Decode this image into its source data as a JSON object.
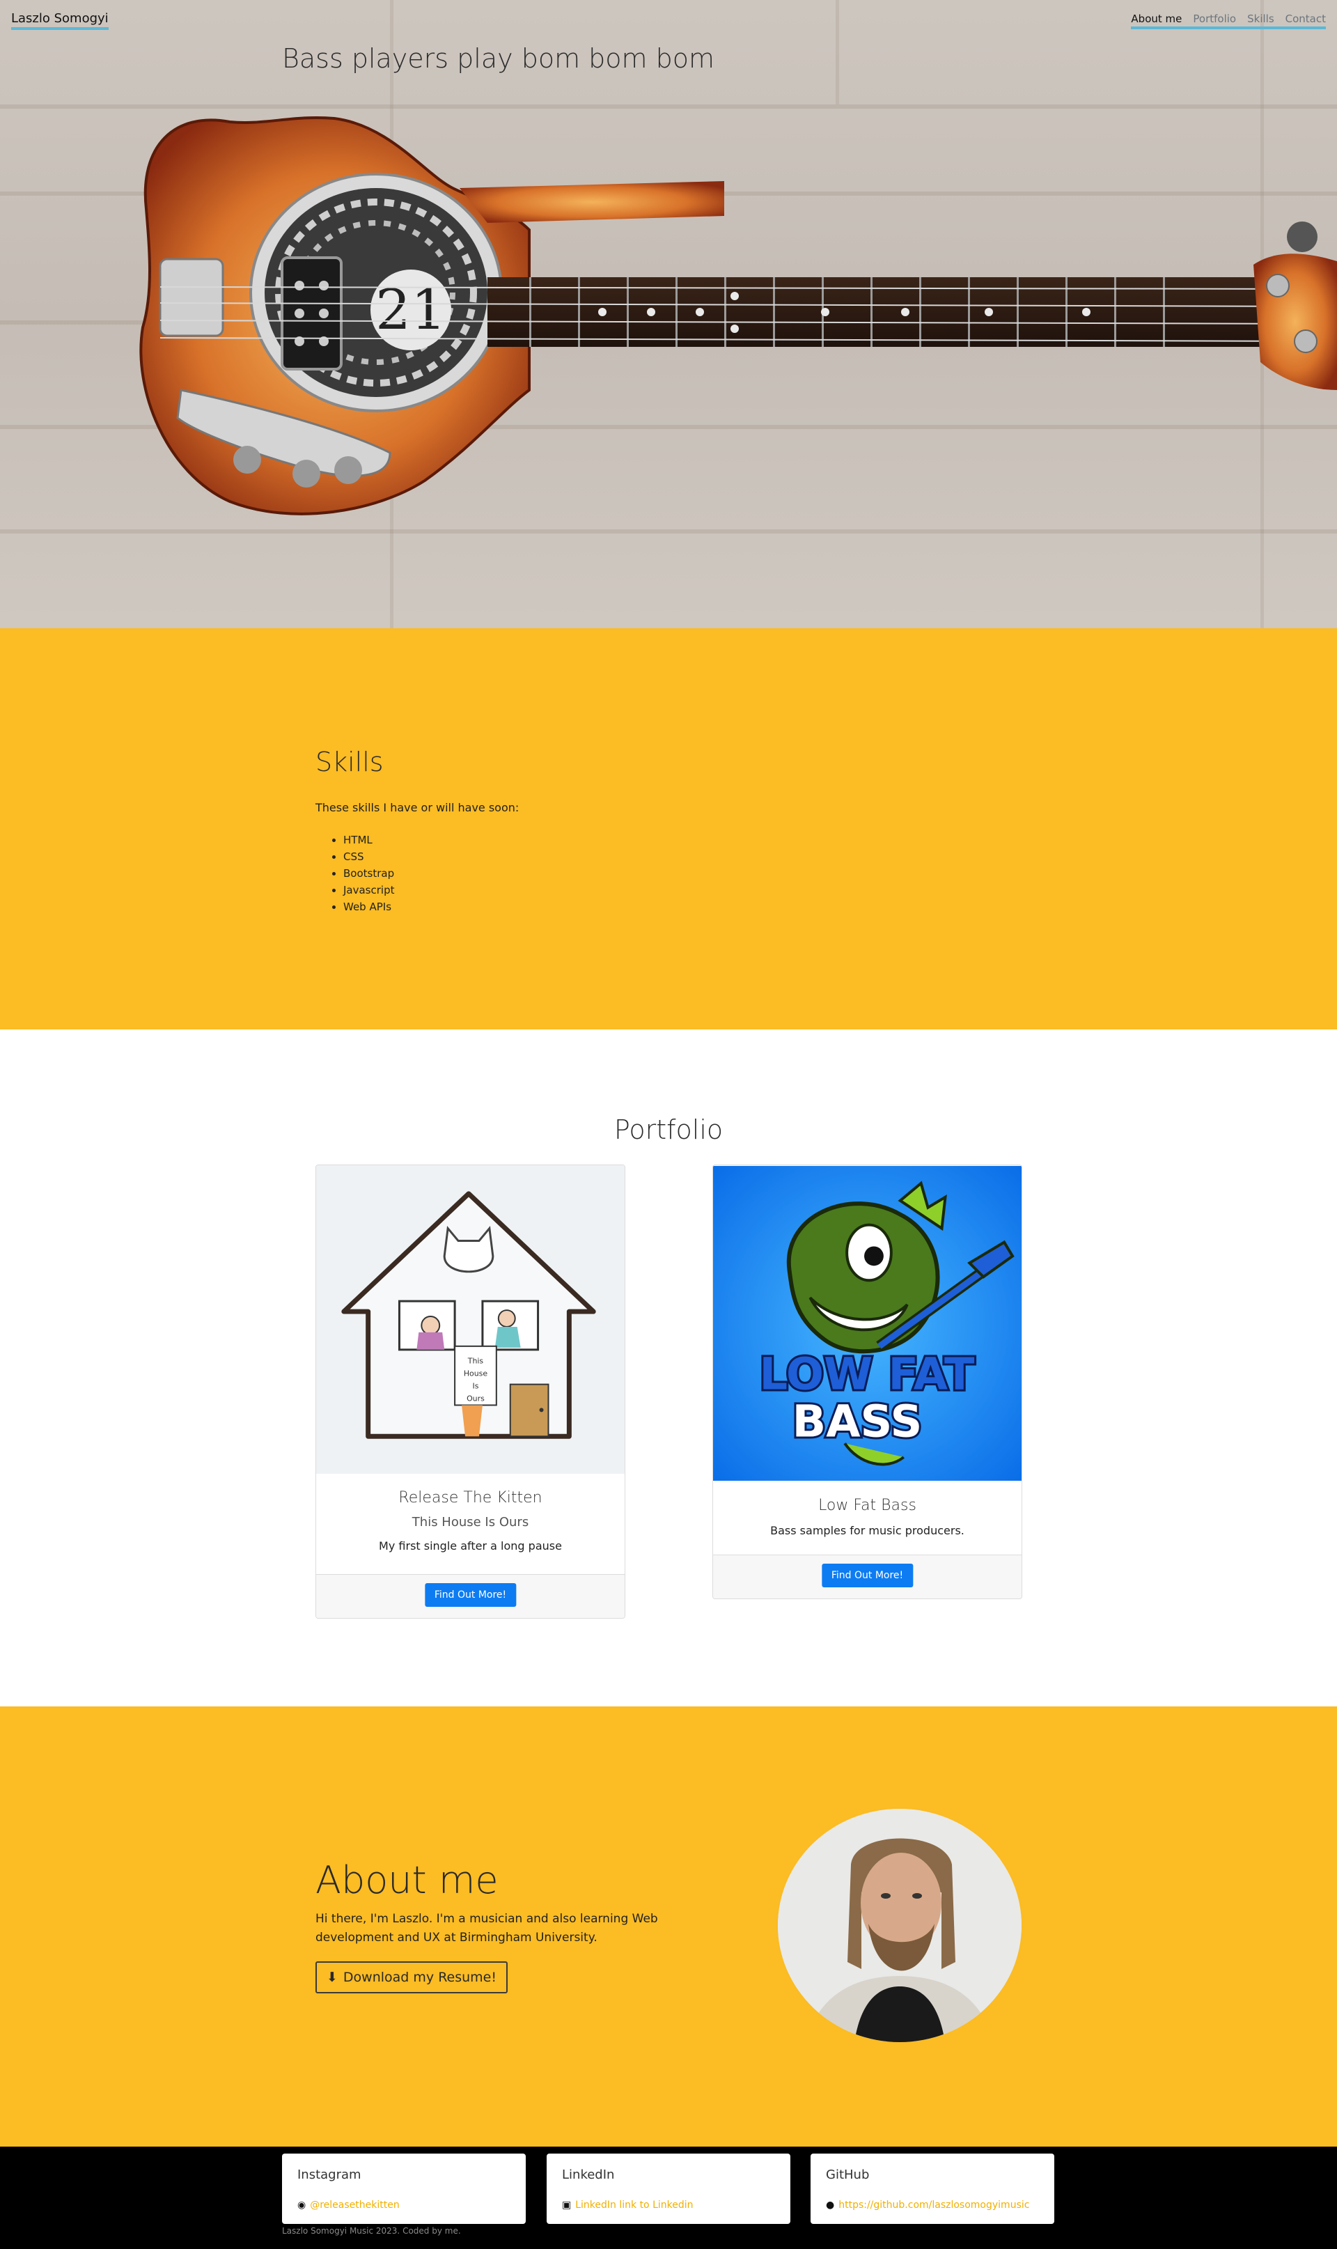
{
  "nav": {
    "brand": "Laszlo Somogyi",
    "links": [
      "About me",
      "Portfolio",
      "Skills",
      "Contact"
    ]
  },
  "hero": {
    "title": "Bass players play bom bom bom"
  },
  "skills": {
    "heading": "Skills",
    "intro": "These skills I have or will have soon:",
    "items": [
      "HTML",
      "CSS",
      "Bootstrap",
      "Javascript",
      "Web APIs"
    ]
  },
  "portfolio": {
    "heading": "Portfolio",
    "cards": [
      {
        "title": "Release The Kitten",
        "subtitle": "This House Is Ours",
        "text": "My first single after a long pause",
        "button": "Find Out More!"
      },
      {
        "title": "Low Fat Bass",
        "text": "Bass samples for music producers.",
        "button": "Find Out More!",
        "logo_line1": "LOW FAT",
        "logo_line2": "BASS"
      }
    ]
  },
  "about": {
    "heading": "About me",
    "text": "Hi there, I'm Laszlo. I'm a musician and also learning Web development and UX at Birmingham University.",
    "button": "Download my Resume!"
  },
  "footer": {
    "cards": [
      {
        "title": "Instagram",
        "link": "@releasethekitten",
        "icon": "instagram-icon"
      },
      {
        "title": "LinkedIn",
        "link": "LinkedIn link to Linkedin",
        "icon": "linkedin-icon"
      },
      {
        "title": "GitHub",
        "link": "https://github.com/laszlosomogyimusic",
        "icon": "github-icon"
      }
    ],
    "copyright": "Laszlo Somogyi Music 2023. Coded by me."
  },
  "colors": {
    "accent": "#fbbc24",
    "button": "#0d7cf2",
    "nav_underline": "#5bb8d6",
    "footer": "#000000"
  }
}
